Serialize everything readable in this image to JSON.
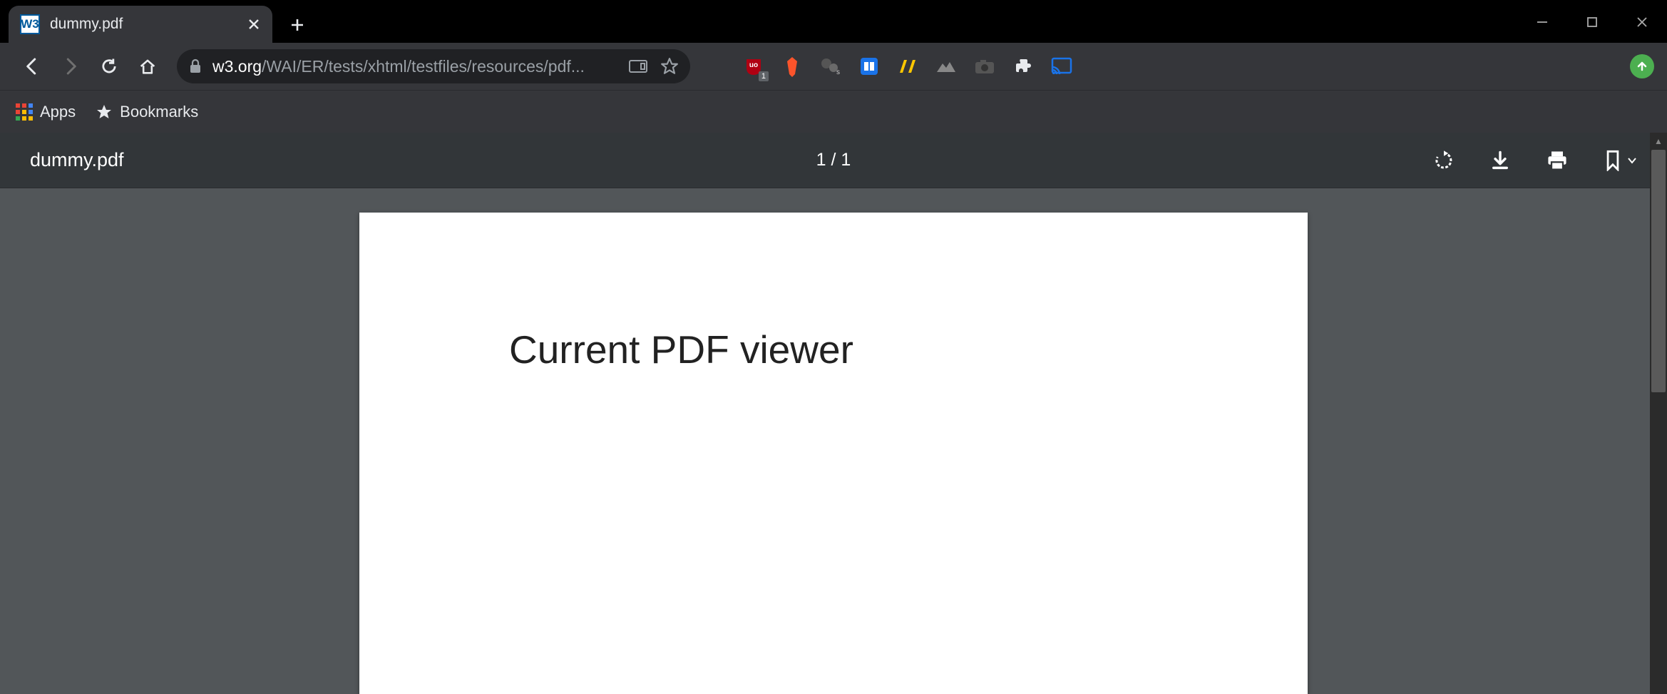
{
  "tab": {
    "title": "dummy.pdf",
    "favicon_text": "W3"
  },
  "url": {
    "host": "w3.org",
    "path": "/WAI/ER/tests/xhtml/testfiles/resources/pdf..."
  },
  "bookmarks_bar": {
    "apps_label": "Apps",
    "bookmarks_label": "Bookmarks"
  },
  "extensions": {
    "ublock_badge": "1"
  },
  "pdf": {
    "filename": "dummy.pdf",
    "page_indicator": "1 / 1",
    "content_heading": "Current PDF viewer"
  }
}
